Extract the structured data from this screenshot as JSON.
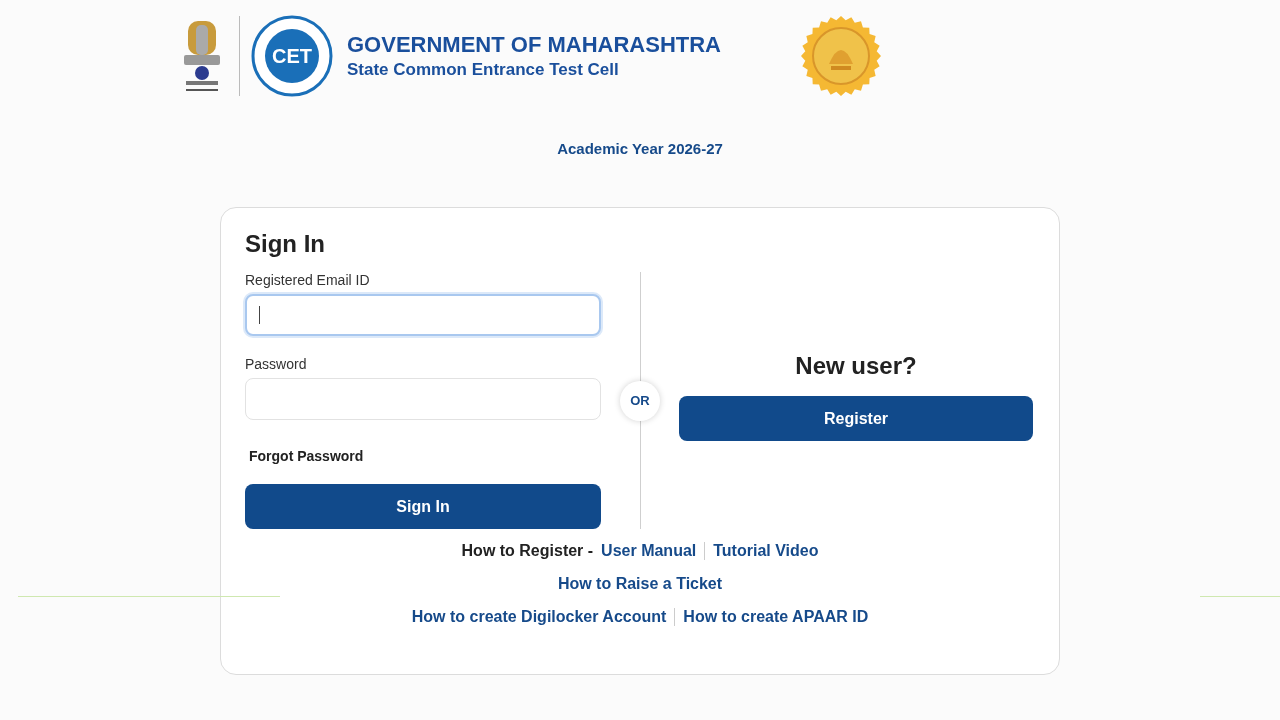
{
  "header": {
    "logo_text": "CET",
    "title": "GOVERNMENT OF MAHARASHTRA",
    "subtitle": "State Common Entrance Test Cell"
  },
  "academic_year": "Academic Year 2026-27",
  "sign_in": {
    "heading": "Sign In",
    "fields": [
      {
        "label": "Registered Email ID",
        "focused": true
      },
      {
        "label": "Password",
        "focused": false
      }
    ],
    "forgot": "Forgot Password",
    "button": "Sign In"
  },
  "separator": "OR",
  "new_user": {
    "heading": "New user?",
    "button": "Register"
  },
  "help_rows": [
    [
      {
        "kind": "label",
        "text": "How to Register -"
      },
      {
        "kind": "link",
        "text": "User Manual"
      },
      {
        "kind": "link",
        "text": "Tutorial Video"
      }
    ],
    [
      {
        "kind": "link",
        "text": "How to Raise a Ticket"
      }
    ],
    [
      {
        "kind": "link",
        "text": "How to create Digilocker Account"
      },
      {
        "kind": "link",
        "text": "How to create APAAR ID"
      }
    ]
  ]
}
